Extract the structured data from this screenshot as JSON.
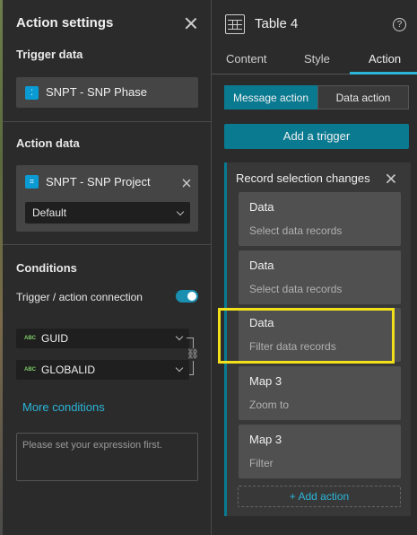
{
  "left_panel": {
    "title": "Action settings",
    "trigger_data": {
      "label": "Trigger data",
      "source": "SNPT - SNP Phase"
    },
    "action_data": {
      "label": "Action data",
      "source": "SNPT - SNP Project",
      "view_select": "Default"
    },
    "conditions": {
      "label": "Conditions",
      "connection_label": "Trigger / action connection",
      "connection_enabled": true,
      "trigger_field_type": "ABC",
      "trigger_field": "GUID",
      "action_field_type": "ABC",
      "action_field": "GLOBALID",
      "more_conditions": "More conditions",
      "expression_placeholder": "Please set your expression first."
    }
  },
  "right_panel": {
    "widget_title": "Table 4",
    "help_glyph": "?",
    "tabs": [
      "Content",
      "Style",
      "Action"
    ],
    "active_tab": "Action",
    "segments": [
      "Message action",
      "Data action"
    ],
    "active_segment": "Message action",
    "add_trigger_label": "Add a trigger",
    "trigger_group": {
      "title": "Record selection changes",
      "actions": [
        {
          "title": "Data",
          "subtitle": "Select data records"
        },
        {
          "title": "Data",
          "subtitle": "Select data records"
        },
        {
          "title": "Data",
          "subtitle": "Filter data records"
        },
        {
          "title": "Map 3",
          "subtitle": "Zoom to"
        },
        {
          "title": "Map 3",
          "subtitle": "Filter"
        }
      ],
      "add_action_label": "+ Add action"
    }
  },
  "colors": {
    "accent": "#2bb5d8",
    "button": "#0a7a91",
    "highlight": "#f2e01a",
    "panel_bg": "#2b2b2b"
  }
}
